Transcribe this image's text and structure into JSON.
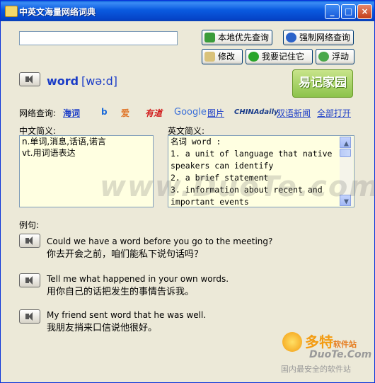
{
  "window": {
    "title": "中英文海量网络词典",
    "min": "_",
    "max": "□",
    "close": "×"
  },
  "search": {
    "value": "",
    "placeholder": ""
  },
  "buttons": {
    "local_first": "本地优先查询",
    "force_online": "强制网络查询",
    "modify": "修改",
    "remember": "我要记住它",
    "float": "浮动"
  },
  "entry": {
    "word": "word",
    "phonetic": "[wə:d]"
  },
  "logo": {
    "text": "易记家园"
  },
  "online": {
    "label": "网络查询:",
    "items": [
      {
        "name": "haici",
        "text": "海词"
      },
      {
        "name": "bing",
        "text": "b"
      },
      {
        "name": "iciba",
        "text": "爱"
      },
      {
        "name": "youdao",
        "text": "有道"
      },
      {
        "name": "google",
        "text": "Google"
      },
      {
        "name": "google-images",
        "text": "图片"
      },
      {
        "name": "chinadaily",
        "text": "CHINAdaily"
      },
      {
        "name": "bilingual-news",
        "text": "双语新闻"
      },
      {
        "name": "open-all",
        "text": "全部打开"
      }
    ]
  },
  "cn_brief": {
    "label": "中文简义:",
    "lines": [
      "n.单词,消息,话语,诺言",
      "vt.用词语表达"
    ]
  },
  "en_brief": {
    "label": "英文简义:",
    "lines": [
      "名词 word :",
      "1. a unit of language that native",
      "speakers can identify",
      "2. a brief statement",
      "3. information about recent and",
      "important events"
    ]
  },
  "examples": {
    "label": "例句:",
    "items": [
      {
        "en": "Could we have a word before you go to the meeting?",
        "cn": "你去开会之前，咱们能私下说句话吗？"
      },
      {
        "en": "Tell me what happened in your own words.",
        "cn": "用你自己的话把发生的事情告诉我。"
      },
      {
        "en": "My friend sent word that he was well.",
        "cn": "我朋友捎来口信说他很好。"
      }
    ]
  },
  "watermark": {
    "text": "www.DuoTe.com"
  },
  "duote": {
    "brand": "多特",
    "suffix": "软件站",
    "domain": "DuoTe.Com",
    "slogan": "国内最安全的软件站"
  },
  "colors": {
    "title_bar": "#0a5be0",
    "link": "#1a3cc7",
    "panel_bg": "#ffffe1",
    "window_bg": "#ece9d8"
  }
}
